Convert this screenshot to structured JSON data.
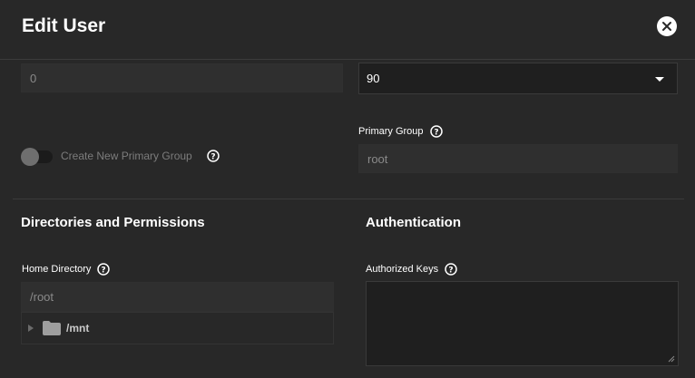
{
  "dialog": {
    "title": "Edit User"
  },
  "icons": {
    "close": "close-icon",
    "help": "help-circle-icon",
    "folder": "folder-icon",
    "dropdown": "chevron-down-icon"
  },
  "fields": {
    "uid_value": "0",
    "group_select_value": "90",
    "create_group_label": "Create New Primary Group",
    "create_group_enabled": false,
    "primary_group_label": "Primary Group",
    "primary_group_value": "root"
  },
  "sections": {
    "directories": "Directories and Permissions",
    "authentication": "Authentication"
  },
  "home": {
    "label": "Home Directory",
    "value": "/root",
    "tree_item": "/mnt"
  },
  "auth": {
    "keys_label": "Authorized Keys",
    "keys_value": ""
  },
  "colors": {
    "background": "#282828",
    "input_bg": "#1f1f1f",
    "disabled_text": "#8a8a8a"
  }
}
